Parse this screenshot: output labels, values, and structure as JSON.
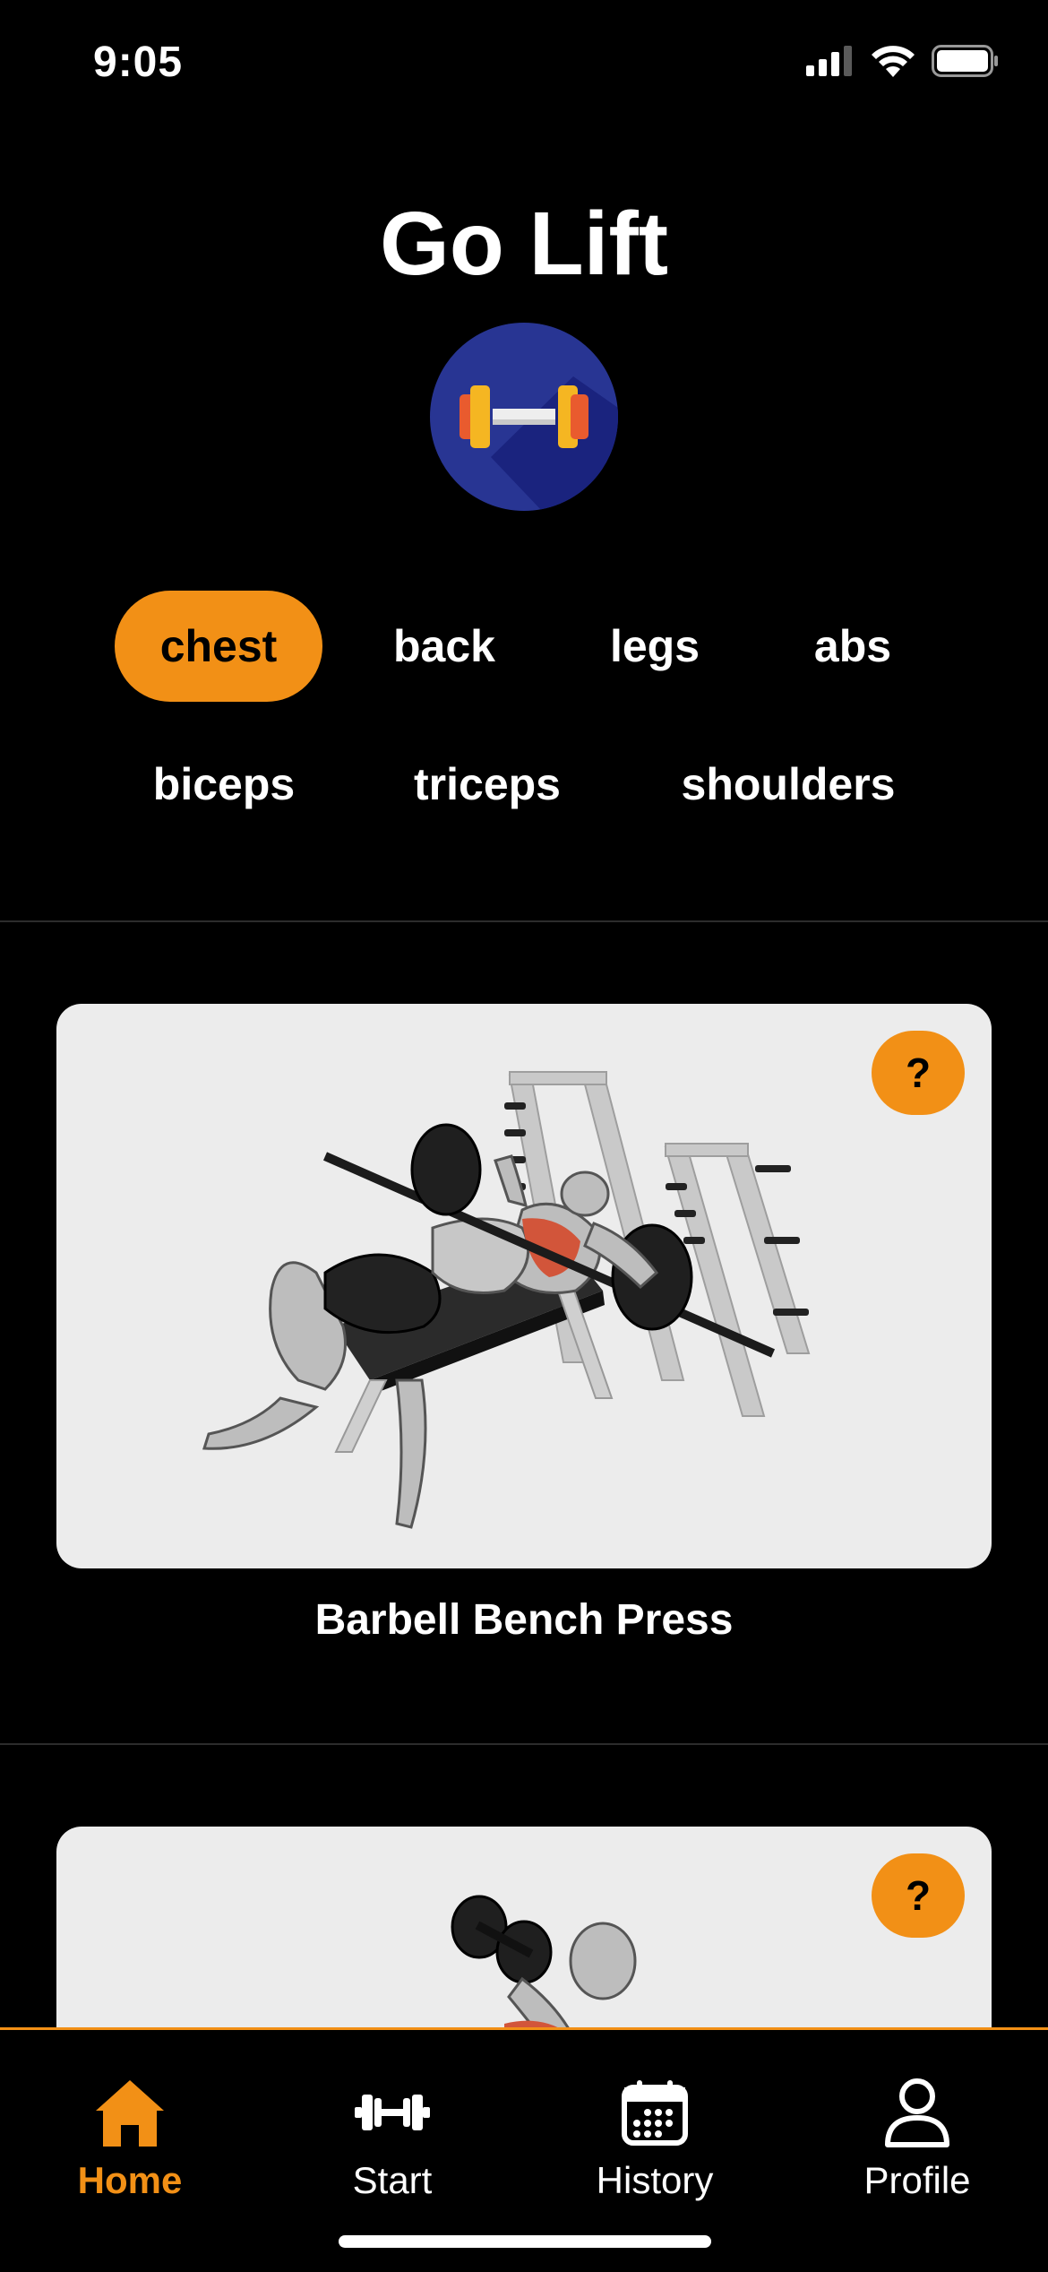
{
  "status_bar": {
    "time": "9:05",
    "icons": [
      "cellular-signal-icon",
      "wifi-icon",
      "battery-icon"
    ]
  },
  "header": {
    "title": "Go Lift",
    "logo_icon": "dumbbell-icon"
  },
  "categories": {
    "row1": [
      "chest",
      "back",
      "legs",
      "abs"
    ],
    "row2": [
      "biceps",
      "triceps",
      "shoulders"
    ],
    "selected": "chest"
  },
  "exercises": [
    {
      "name": "Barbell Bench Press",
      "help_label": "?"
    },
    {
      "name": "",
      "help_label": "?"
    }
  ],
  "tab_bar": {
    "tabs": [
      {
        "label": "Home",
        "icon": "home-icon"
      },
      {
        "label": "Start",
        "icon": "dumbbell-icon"
      },
      {
        "label": "History",
        "icon": "calendar-icon"
      },
      {
        "label": "Profile",
        "icon": "user-icon"
      }
    ],
    "active": "Home"
  },
  "colors": {
    "accent": "#F29016",
    "background": "#000000",
    "card": "#ECECEC",
    "logo_bg": "#283593"
  }
}
